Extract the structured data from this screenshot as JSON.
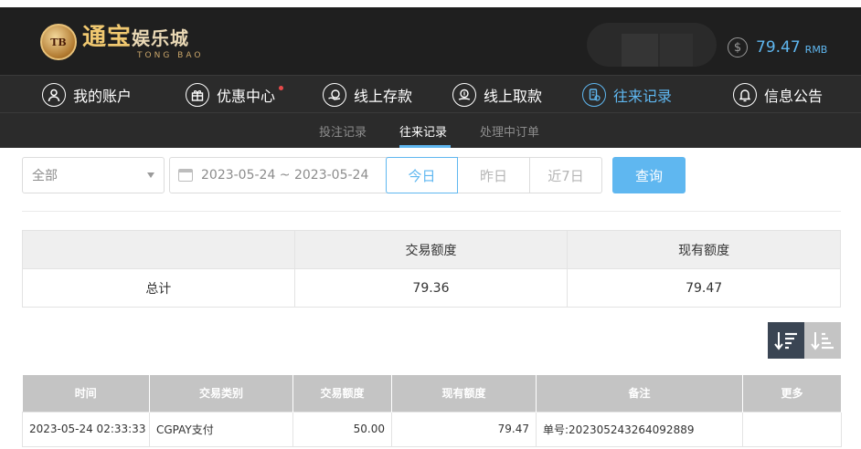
{
  "brand": {
    "badge": "TB",
    "name_main": "通宝",
    "name_rest": "娱乐城",
    "name_sub": "TONG BAO"
  },
  "balance": {
    "symbol": "$",
    "amount": "79.47",
    "unit": "RMB"
  },
  "nav": {
    "items": [
      {
        "label": "我的账户",
        "icon": "user-icon"
      },
      {
        "label": "优惠中心",
        "icon": "gift-icon",
        "dot": true
      },
      {
        "label": "线上存款",
        "icon": "deposit-icon"
      },
      {
        "label": "线上取款",
        "icon": "withdraw-icon"
      },
      {
        "label": "往来记录",
        "icon": "records-icon",
        "active": true
      },
      {
        "label": "信息公告",
        "icon": "bell-icon"
      }
    ]
  },
  "subnav": {
    "items": [
      {
        "label": "投注记录"
      },
      {
        "label": "往来记录",
        "active": true
      },
      {
        "label": "处理中订单"
      }
    ]
  },
  "filters": {
    "type_select": "全部",
    "date_range": "2023-05-24 ~ 2023-05-24",
    "segments": [
      "今日",
      "昨日",
      "近7日"
    ],
    "active_segment": "今日",
    "query_label": "查询"
  },
  "summary": {
    "headers": [
      "",
      "交易额度",
      "现有额度"
    ],
    "row": [
      "总计",
      "79.36",
      "79.47"
    ]
  },
  "sort": {
    "desc_icon": "sort-desc-icon",
    "asc_icon": "sort-asc-icon"
  },
  "records": {
    "headers": [
      "时间",
      "交易类别",
      "交易额度",
      "现有额度",
      "备注",
      "更多"
    ],
    "rows": [
      [
        "2023-05-24 02:33:33",
        "CGPAY支付",
        "50.00",
        "79.47",
        "单号:2023052432640928​89",
        ""
      ]
    ]
  },
  "colors": {
    "accent": "#5fb7f0",
    "header_bg": "#1f1f1f",
    "nav_bg": "#2b2b2b",
    "badge_dot": "#e64a4a"
  }
}
